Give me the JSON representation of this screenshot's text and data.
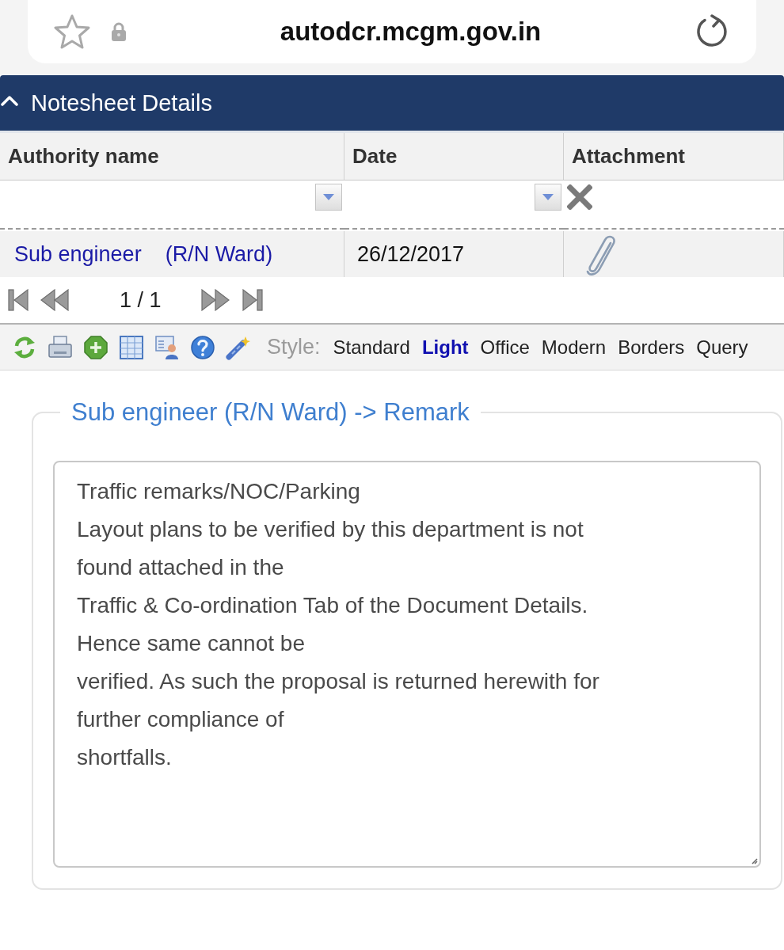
{
  "browser": {
    "url": "autodcr.mcgm.gov.in"
  },
  "panel": {
    "title": "Notesheet Details",
    "expanded": true
  },
  "table": {
    "columns": [
      "Authority name",
      "Date",
      "Attachment"
    ],
    "rows": [
      {
        "authority": "Sub engineer    (R/N Ward)",
        "date": "26/12/2017",
        "attachment": true
      }
    ]
  },
  "pager": {
    "page_info": "1 / 1"
  },
  "toolbar": {
    "style_label": "Style:",
    "styles": [
      {
        "label": "Standard",
        "selected": false
      },
      {
        "label": "Light",
        "selected": true
      },
      {
        "label": "Office",
        "selected": false
      },
      {
        "label": "Modern",
        "selected": false
      },
      {
        "label": "Borders",
        "selected": false
      },
      {
        "label": "Query",
        "selected": false
      }
    ]
  },
  "remark": {
    "legend": "Sub engineer (R/N Ward) -> Remark",
    "text": "Traffic remarks/NOC/Parking\nLayout plans to be verified by this department is not\nfound attached in the\nTraffic & Co-ordination Tab of the Document Details.\nHence same cannot be\nverified. As such the proposal is returned herewith for\nfurther compliance of\nshortfalls."
  }
}
